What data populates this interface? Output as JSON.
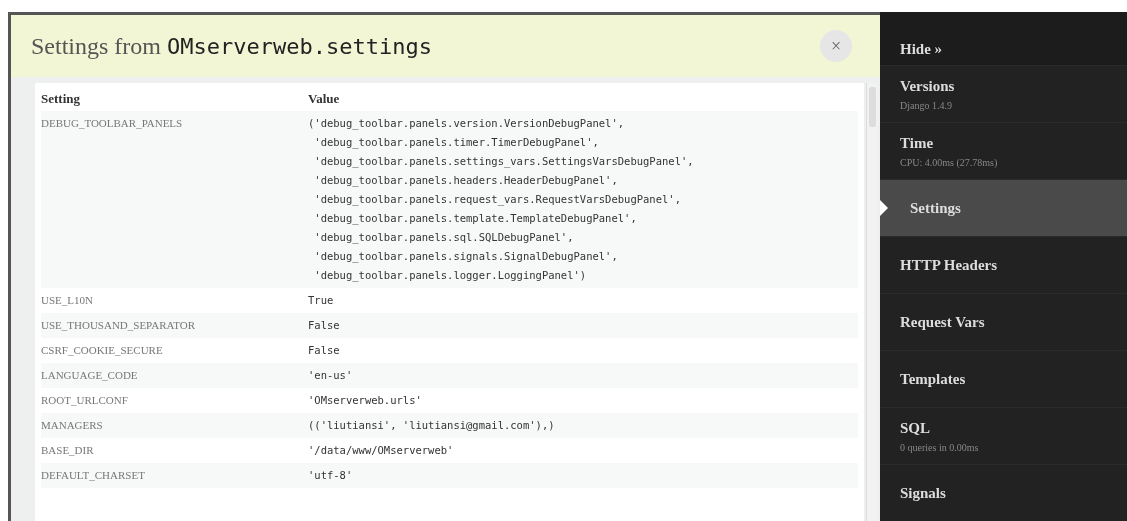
{
  "panel": {
    "title_prefix": "Settings from",
    "title_module": "OMserverweb.settings",
    "close_label": "×"
  },
  "table": {
    "columns": [
      "Setting",
      "Value"
    ],
    "rows": [
      {
        "setting": "DEBUG_TOOLBAR_PANELS",
        "value_lines": [
          "('debug_toolbar.panels.version.VersionDebugPanel',",
          " 'debug_toolbar.panels.timer.TimerDebugPanel',",
          " 'debug_toolbar.panels.settings_vars.SettingsVarsDebugPanel',",
          " 'debug_toolbar.panels.headers.HeaderDebugPanel',",
          " 'debug_toolbar.panels.request_vars.RequestVarsDebugPanel',",
          " 'debug_toolbar.panels.template.TemplateDebugPanel',",
          " 'debug_toolbar.panels.sql.SQLDebugPanel',",
          " 'debug_toolbar.panels.signals.SignalDebugPanel',",
          " 'debug_toolbar.panels.logger.LoggingPanel')"
        ]
      },
      {
        "setting": "USE_L10N",
        "value_lines": [
          "True"
        ]
      },
      {
        "setting": "USE_THOUSAND_SEPARATOR",
        "value_lines": [
          "False"
        ]
      },
      {
        "setting": "CSRF_COOKIE_SECURE",
        "value_lines": [
          "False"
        ]
      },
      {
        "setting": "LANGUAGE_CODE",
        "value_lines": [
          "'en-us'"
        ]
      },
      {
        "setting": "ROOT_URLCONF",
        "value_lines": [
          "'OMserverweb.urls'"
        ]
      },
      {
        "setting": "MANAGERS",
        "value_lines": [
          "(('liutiansi', 'liutiansi@gmail.com'),)"
        ]
      },
      {
        "setting": "BASE_DIR",
        "value_lines": [
          "'/data/www/OMserverweb'"
        ]
      },
      {
        "setting": "DEFAULT_CHARSET",
        "value_lines": [
          "'utf-8'"
        ]
      }
    ]
  },
  "sidebar": {
    "hide_label": "Hide »",
    "items": [
      {
        "label": "Versions",
        "subtitle": "Django 1.4.9",
        "selected": false
      },
      {
        "label": "Time",
        "subtitle": "CPU: 4.00ms (27.78ms)",
        "selected": false
      },
      {
        "label": "Settings",
        "selected": true
      },
      {
        "label": "HTTP Headers",
        "selected": false
      },
      {
        "label": "Request Vars",
        "selected": false
      },
      {
        "label": "Templates",
        "selected": false
      },
      {
        "label": "SQL",
        "subtitle": "0 queries in 0.00ms",
        "selected": false
      },
      {
        "label": "Signals",
        "selected": false
      }
    ]
  }
}
